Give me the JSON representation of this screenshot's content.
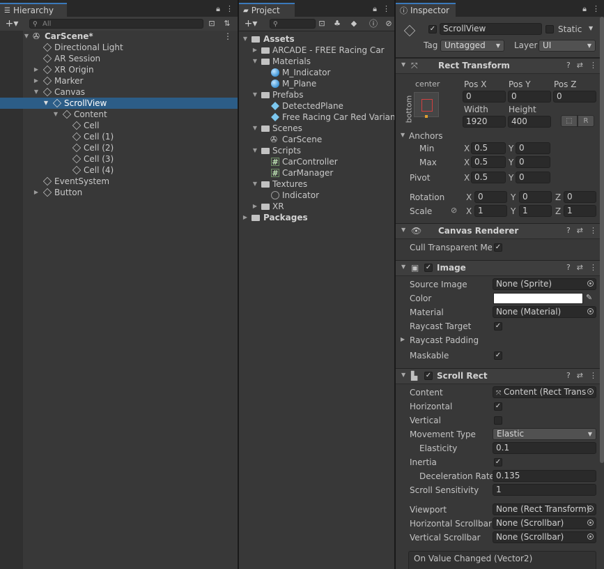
{
  "hierarchy": {
    "tab": "Hierarchy",
    "search_placeholder": "All",
    "scene": "CarScene*",
    "items": [
      {
        "label": "Directional Light"
      },
      {
        "label": "AR Session"
      },
      {
        "label": "XR Origin"
      },
      {
        "label": "Marker"
      },
      {
        "label": "Canvas"
      },
      {
        "label": "ScrollView"
      },
      {
        "label": "Content"
      },
      {
        "label": "Cell"
      },
      {
        "label": "Cell (1)"
      },
      {
        "label": "Cell (2)"
      },
      {
        "label": "Cell (3)"
      },
      {
        "label": "Cell (4)"
      },
      {
        "label": "EventSystem"
      },
      {
        "label": "Button"
      }
    ]
  },
  "project": {
    "tab": "Project",
    "items": [
      {
        "label": "Assets"
      },
      {
        "label": "ARCADE - FREE Racing Car"
      },
      {
        "label": "Materials"
      },
      {
        "label": "M_Indicator"
      },
      {
        "label": "M_Plane"
      },
      {
        "label": "Prefabs"
      },
      {
        "label": "DetectedPlane"
      },
      {
        "label": "Free Racing Car Red Variant"
      },
      {
        "label": "Scenes"
      },
      {
        "label": "CarScene"
      },
      {
        "label": "Scripts"
      },
      {
        "label": "CarController"
      },
      {
        "label": "CarManager"
      },
      {
        "label": "Textures"
      },
      {
        "label": "Indicator"
      },
      {
        "label": "XR"
      },
      {
        "label": "Packages"
      }
    ]
  },
  "inspector": {
    "tab": "Inspector",
    "object_name": "ScrollView",
    "static_label": "Static",
    "tag_label": "Tag",
    "tag_value": "Untagged",
    "layer_label": "Layer",
    "layer_value": "UI",
    "rect_transform": {
      "title": "Rect Transform",
      "anchor_h": "center",
      "anchor_v": "bottom",
      "posx_label": "Pos X",
      "posx": "0",
      "posy_label": "Pos Y",
      "posy": "0",
      "posz_label": "Pos Z",
      "posz": "0",
      "width_label": "Width",
      "width": "1920",
      "height_label": "Height",
      "height": "400",
      "r_button": "R",
      "anchors_label": "Anchors",
      "min_label": "Min",
      "min_x": "0.5",
      "min_y": "0",
      "max_label": "Max",
      "max_x": "0.5",
      "max_y": "0",
      "pivot_label": "Pivot",
      "pivot_x": "0.5",
      "pivot_y": "0",
      "rotation_label": "Rotation",
      "rot_x": "0",
      "rot_y": "0",
      "rot_z": "0",
      "scale_label": "Scale",
      "scale_x": "1",
      "scale_y": "1",
      "scale_z": "1",
      "x": "X",
      "y": "Y",
      "z": "Z"
    },
    "canvas_renderer": {
      "title": "Canvas Renderer",
      "cull_label": "Cull Transparent Mes"
    },
    "image": {
      "title": "Image",
      "source_label": "Source Image",
      "source_value": "None (Sprite)",
      "color_label": "Color",
      "color_value": "#ffffff",
      "material_label": "Material",
      "material_value": "None (Material)",
      "raycast_label": "Raycast Target",
      "padding_label": "Raycast Padding",
      "maskable_label": "Maskable"
    },
    "scroll_rect": {
      "title": "Scroll Rect",
      "content_label": "Content",
      "content_value": "Content (Rect Trans",
      "horizontal_label": "Horizontal",
      "vertical_label": "Vertical",
      "movement_label": "Movement Type",
      "movement_value": "Elastic",
      "elasticity_label": "Elasticity",
      "elasticity_value": "0.1",
      "inertia_label": "Inertia",
      "decel_label": "Deceleration Rate",
      "decel_value": "0.135",
      "sens_label": "Scroll Sensitivity",
      "sens_value": "1",
      "viewport_label": "Viewport",
      "viewport_value": "None (Rect Transform)",
      "hscroll_label": "Horizontal Scrollbar",
      "hscroll_value": "None (Scrollbar)",
      "vscroll_label": "Vertical Scrollbar",
      "vscroll_value": "None (Scrollbar)",
      "event_label": "On Value Changed (Vector2)"
    }
  }
}
